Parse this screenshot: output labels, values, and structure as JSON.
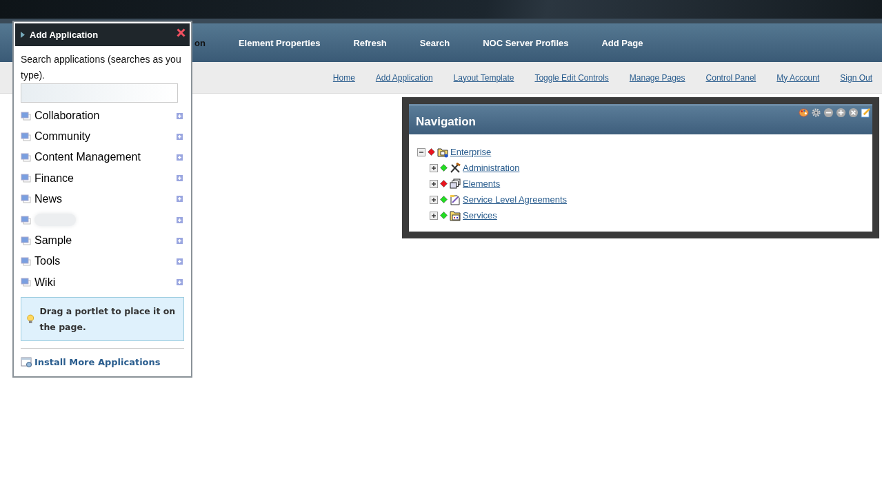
{
  "main_nav": [
    {
      "label": "on",
      "kind": "partial"
    },
    {
      "label": "Element Properties",
      "kind": "item"
    },
    {
      "label": "Refresh",
      "kind": "item"
    },
    {
      "label": "Search",
      "kind": "item"
    },
    {
      "label": "NOC Server Profiles",
      "kind": "item"
    },
    {
      "label": "Add Page",
      "kind": "item"
    }
  ],
  "user_links": [
    "Home",
    "Add Application",
    "Layout Template",
    "Toggle Edit Controls",
    "Manage Pages",
    "Control Panel",
    "My Account",
    "Sign Out"
  ],
  "add_application": {
    "title": "Add Application",
    "search_hint": "Search applications (searches as you type).",
    "categories": [
      {
        "kind": "named",
        "label": "Collaboration"
      },
      {
        "kind": "named",
        "label": "Community"
      },
      {
        "kind": "named",
        "label": "Content Management"
      },
      {
        "kind": "named",
        "label": "Finance"
      },
      {
        "kind": "named",
        "label": "News"
      },
      {
        "kind": "blurred"
      },
      {
        "kind": "named",
        "label": "Sample"
      },
      {
        "kind": "named",
        "label": "Tools"
      },
      {
        "kind": "named",
        "label": "Wiki"
      }
    ],
    "tip": "Drag a portlet to place it on the page.",
    "install_link": "Install More Applications"
  },
  "navigation_portlet": {
    "title": "Navigation",
    "tree": [
      {
        "label": "Enterprise",
        "color": "#e8141e",
        "kind": "root",
        "expanded": true,
        "children": [
          {
            "label": "Administration",
            "color": "#22dd22",
            "kind": "admin",
            "expanded": false
          },
          {
            "label": "Elements",
            "color": "#e8141e",
            "kind": "elements",
            "expanded": false
          },
          {
            "label": "Service Level Agreements",
            "color": "#22dd22",
            "kind": "agreements",
            "expanded": false
          },
          {
            "label": "Services",
            "color": "#22dd22",
            "kind": "services",
            "expanded": false
          }
        ]
      }
    ]
  }
}
